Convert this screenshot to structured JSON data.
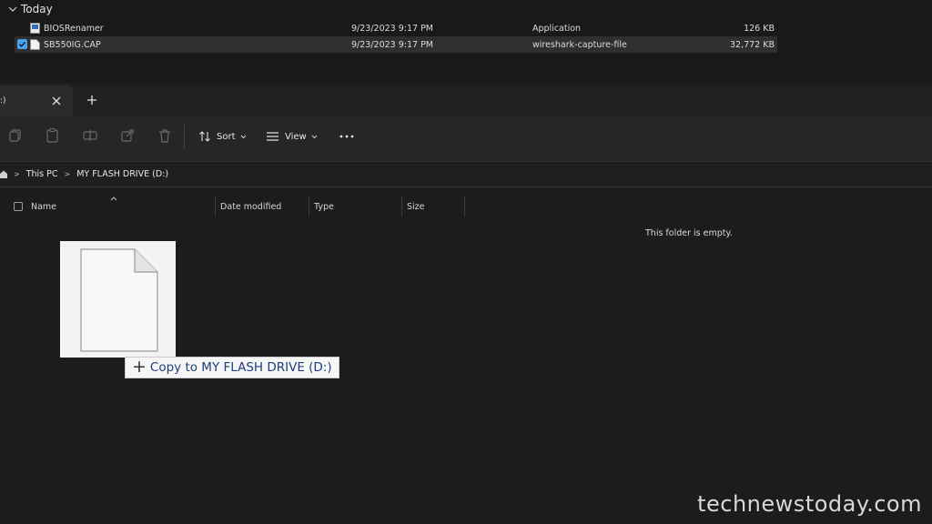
{
  "background_window": {
    "group_label": "Today",
    "files": [
      {
        "name": "BIOSRenamer",
        "date_modified": "9/23/2023 9:17 PM",
        "type": "Application",
        "size": "126 KB",
        "selected": false
      },
      {
        "name": "SB550IG.CAP",
        "date_modified": "9/23/2023 9:17 PM",
        "type": "wireshark-capture-file",
        "size": "32,772 KB",
        "selected": true
      }
    ]
  },
  "front_window": {
    "tab": {
      "title": ":)"
    },
    "toolbar": {
      "sort_label": "Sort",
      "view_label": "View"
    },
    "breadcrumb": [
      "This PC",
      "MY FLASH DRIVE (D:)"
    ],
    "columns": [
      "Name",
      "Date modified",
      "Type",
      "Size"
    ],
    "empty_message": "This folder is empty."
  },
  "drag": {
    "tooltip_text": "Copy to MY FLASH DRIVE (D:)"
  },
  "watermark": "technewstoday.com",
  "colors": {
    "accent_check": "#4aa3e8",
    "tooltip_text": "#1f3f7a"
  },
  "icons": [
    "chevron-down-icon",
    "application-file-icon",
    "capture-file-icon",
    "close-icon",
    "plus-icon",
    "copy-icon",
    "paste-icon",
    "rename-icon",
    "share-icon",
    "delete-icon",
    "sort-icon",
    "view-icon",
    "more-icon",
    "home-icon",
    "blank-file-icon"
  ]
}
